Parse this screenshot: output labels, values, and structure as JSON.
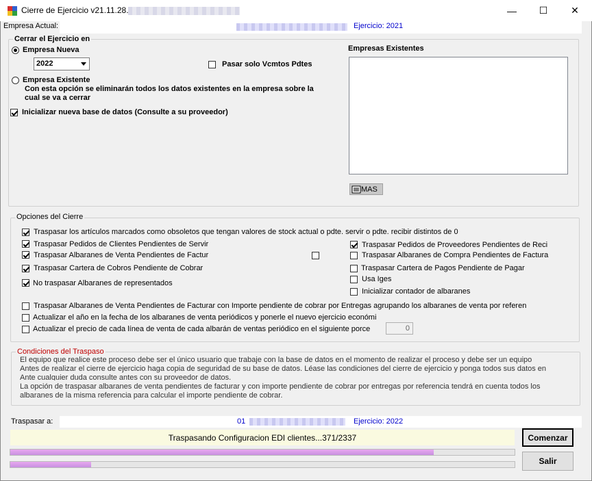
{
  "window": {
    "title": "Cierre de Ejercicio v21.11.28.0",
    "minimize": "—",
    "maximize": "☐",
    "close": "✕"
  },
  "header": {
    "empresa_label": "Empresa Actual:",
    "ejercicio_actual": "Ejercicio: 2021"
  },
  "cerrar_group": {
    "legend": "Cerrar el Ejercicio en",
    "empresa_nueva": "Empresa Nueva",
    "year_value": "2022",
    "pasar_vcmtos": "Pasar solo Vcmtos Pdtes",
    "empresa_existente": "Empresa Existente",
    "warning_line1": "Con esta opción se eliminarán todos los datos existentes en la empresa sobre la",
    "warning_line2": "cual se va a cerrar",
    "inicializar": "Inicializar nueva base de datos (Consulte a su proveedor)",
    "empresas_existentes": "Empresas Existentes",
    "mas_button": "MAS"
  },
  "opciones_group": {
    "legend": "Opciones del Cierre",
    "obsoletos": "Traspasar los artículos marcados como obsoletos que tengan valores de stock actual o pdte. servir o pdte. recibir distintos de 0",
    "pedidos_clientes": "Traspasar Pedidos de Clientes Pendientes de Servir",
    "albaranes_venta": "Traspasar Albaranes de Venta Pendientes de Factur",
    "cartera_cobros": "Traspasar Cartera de Cobros Pendiente de Cobrar",
    "no_traspasar_repr": "No traspasar Albaranes de representados",
    "pedidos_proveedores": "Traspasar Pedidos de Proveedores Pendientes de Reci",
    "albaranes_compra": "Traspasar Albaranes de Compra Pendientes de Factura",
    "cartera_pagos": "Traspasar Cartera de Pagos Pendiente de Pagar",
    "usa_iges": "Usa Iges",
    "inicializar_contador": "Inicializar contador de albaranes",
    "albaranes_entregas": "Traspasar Albaranes de Venta Pendientes de Facturar con Importe pendiente de cobrar por Entregas agrupando los albaranes de venta por referen",
    "actualizar_anio": "Actualizar el año en la fecha de los albaranes de venta periódicos y ponerle el nuevo ejercicio económi",
    "actualizar_precio": "Actualizar el precio de cada línea de venta de cada albarán de ventas periódico en el siguiente porce",
    "porcentaje": "0"
  },
  "condiciones_group": {
    "legend": "Condiciones del Traspaso",
    "lines": [
      "El equipo que realice este proceso debe ser el único usuario que trabaje con la base de datos en el momento de realizar el proceso y debe ser un equipo",
      "Antes de realizar el cierre de ejercicio haga copia de seguridad de su base de datos. Léase las condiciones del cierre de ejercicio y ponga todos sus datos en",
      "Ante cualquier duda consulte antes con su proveedor de datos.",
      "La opción de traspasar albaranes de venta pendientes de facturar y con importe pendiente de cobrar por entregas por referencia tendrá en cuenta todos los",
      "albaranes de la misma referencia para calcular el importe pendiente de cobrar."
    ]
  },
  "footer": {
    "traspasar_label": "Traspasar a:",
    "empresa_code": "01",
    "ejercicio_destino": "Ejercicio: 2022",
    "status": "Traspasando Configuracion EDI clientes...371/2337",
    "progress1": 0.84,
    "progress2": 0.16,
    "comenzar": "Comenzar",
    "salir": "Salir"
  },
  "colors": {
    "legend_red": "#c00000",
    "link_blue": "#0000cc",
    "status_bg": "#fafae0",
    "progress_fill": "#d8a0ec"
  }
}
